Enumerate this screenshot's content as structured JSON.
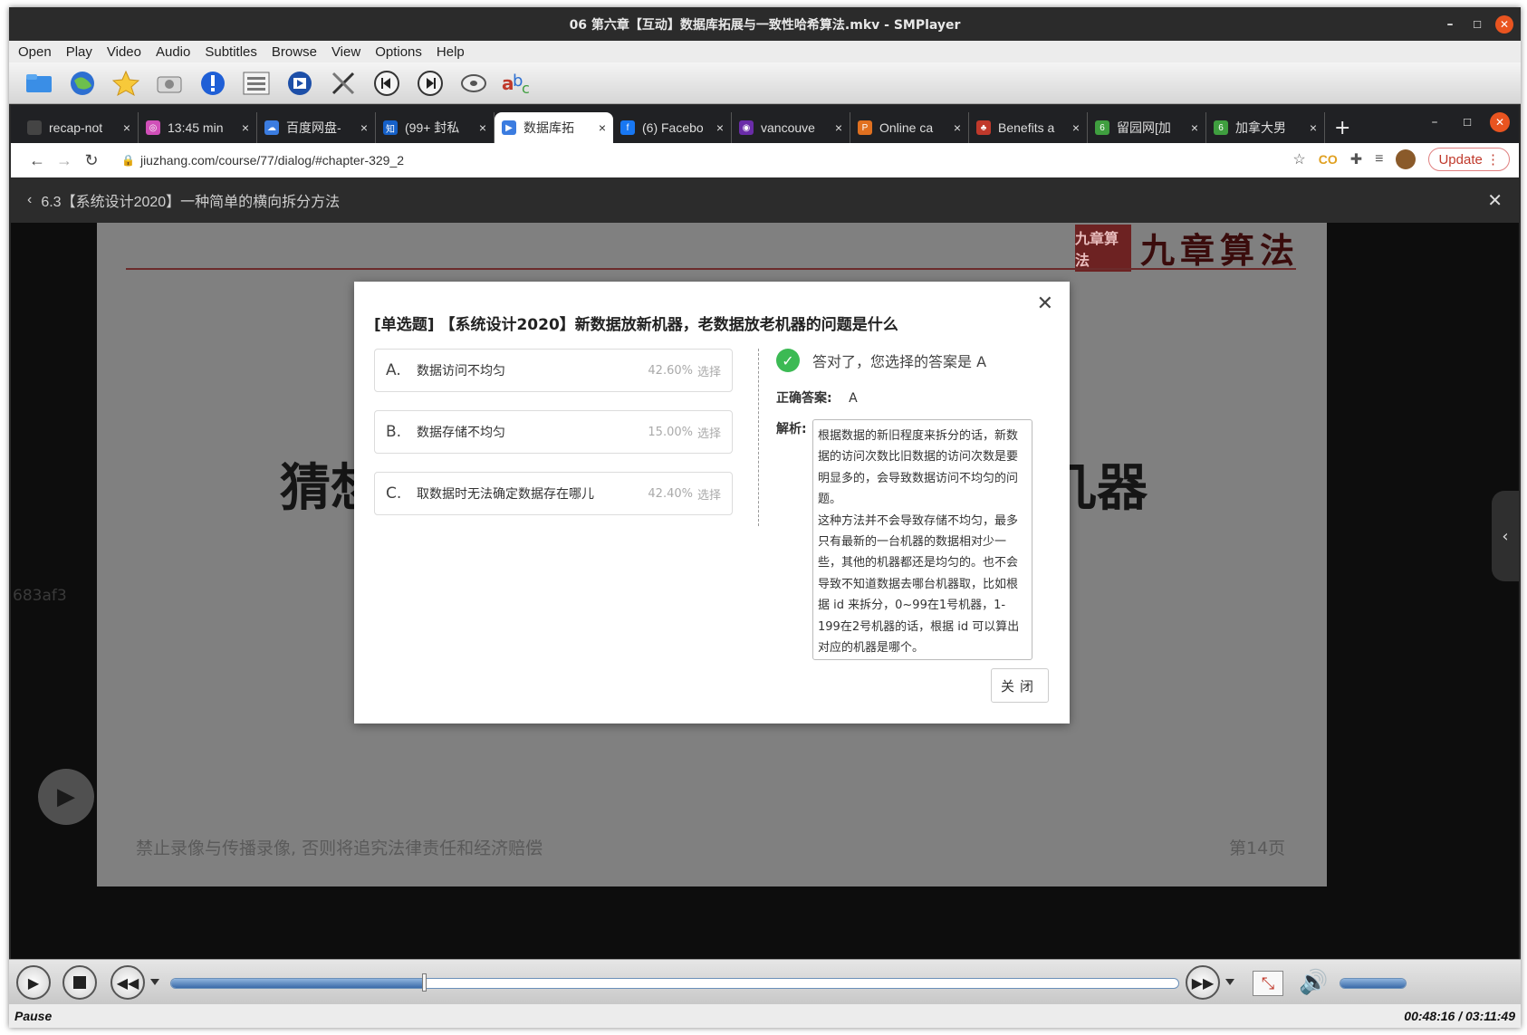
{
  "window": {
    "title": "06 第六章【互动】数据库拓展与一致性哈希算法.mkv - SMPlayer",
    "minimize": "–",
    "maximize": "☐",
    "close": "✕"
  },
  "menubar": [
    "Open",
    "Play",
    "Video",
    "Audio",
    "Subtitles",
    "Browse",
    "View",
    "Options",
    "Help"
  ],
  "toolbar_icons": [
    "folder-icon",
    "globe-icon",
    "star-icon",
    "camera-icon",
    "info-icon",
    "playlist-icon",
    "settings-icon",
    "tools-icon",
    "previous-icon",
    "next-icon",
    "disc-icon",
    "subtitle-icon"
  ],
  "browser": {
    "tabs": [
      {
        "title": "recap-not",
        "fav_color": "#444444",
        "fav_glyph": ""
      },
      {
        "title": "13:45 min",
        "fav_color": "#d04fb8",
        "fav_glyph": "◎"
      },
      {
        "title": "百度网盘-",
        "fav_color": "#3b7ce0",
        "fav_glyph": "☁"
      },
      {
        "title": "(99+ 封私",
        "fav_color": "#1560c8",
        "fav_glyph": "知"
      },
      {
        "title": "数据库拓",
        "fav_color": "#3b7ce0",
        "fav_glyph": "▶",
        "active": true
      },
      {
        "title": "(6) Facebo",
        "fav_color": "#1877f2",
        "fav_glyph": "f"
      },
      {
        "title": "vancouve",
        "fav_color": "#6a2ca8",
        "fav_glyph": "◉"
      },
      {
        "title": "Online ca",
        "fav_color": "#e07020",
        "fav_glyph": "P"
      },
      {
        "title": "Benefits a",
        "fav_color": "#c0392b",
        "fav_glyph": "♣"
      },
      {
        "title": "留园网[加",
        "fav_color": "#3f9e3f",
        "fav_glyph": "6"
      },
      {
        "title": "加拿大男",
        "fav_color": "#3f9e3f",
        "fav_glyph": "6"
      }
    ],
    "tab_close": "×",
    "new_tab": "+",
    "url": "jiuzhang.com/course/77/dialog/#chapter-329_2",
    "update_label": "Update",
    "course_title": "6.3【系统设计2020】一种简单的横向拆分方法"
  },
  "slide": {
    "logo_seal": "九章算法",
    "logo_text": "九章算法",
    "headline_left": "猜想",
    "headline_right": "几器",
    "footer_warning": "禁止录像与传播录像, 否则将追究法律责任和经济赔偿",
    "page": "第14页",
    "side_hash": "683af3"
  },
  "quiz": {
    "title": "[单选题] 【系统设计2020】新数据放新机器，老数据放老机器的问题是什么",
    "options": [
      {
        "letter": "A.",
        "text": "数据访问不均匀",
        "percent": "42.60%",
        "select": "选择"
      },
      {
        "letter": "B.",
        "text": "数据存储不均匀",
        "percent": "15.00%",
        "select": "选择"
      },
      {
        "letter": "C.",
        "text": "取数据时无法确定数据存在哪儿",
        "percent": "42.40%",
        "select": "选择"
      }
    ],
    "result_text": "答对了，您选择的答案是 A",
    "correct_label": "正确答案:",
    "correct_value": "A",
    "analysis_label": "解析:",
    "analysis_p1": "根据数据的新旧程度来拆分的话，新数据的访问次数比旧数据的访问次数是要明显多的，会导致数据访问不均匀的问题。",
    "analysis_p2": "这种方法并不会导致存储不均匀，最多只有最新的一台机器的数据相对少一些，其他的机器都还是均匀的。也不会导致不知道数据去哪台机器取，比如根据 id 来拆分，0~99在1号机器，1-199在2号机器的话，根据 id 可以算出对应的机器是哪个。",
    "close_label": "关闭"
  },
  "player": {
    "progress": 0.2516,
    "volume": 1.0,
    "state": "Pause",
    "time": "00:48:16 / 03:11:49"
  }
}
